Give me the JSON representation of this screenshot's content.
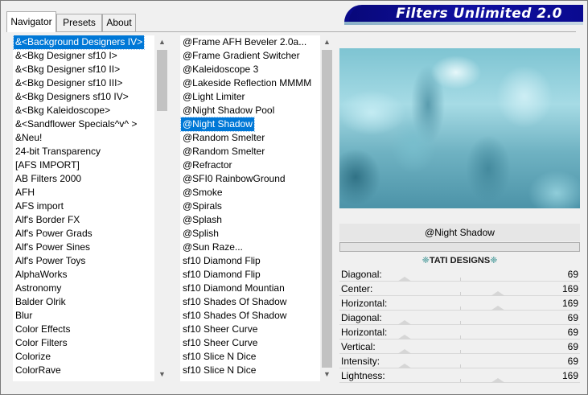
{
  "tabs": [
    {
      "label": "Navigator",
      "active": true
    },
    {
      "label": "Presets",
      "active": false
    },
    {
      "label": "About",
      "active": false
    }
  ],
  "banner": {
    "title": "Filters Unlimited 2.0"
  },
  "categories": {
    "selected_index": 0,
    "items": [
      "&<Background Designers IV>",
      "&<Bkg Designer sf10 I>",
      "&<Bkg Designer sf10 II>",
      "&<Bkg Designer sf10 III>",
      "&<Bkg Designers sf10 IV>",
      "&<Bkg Kaleidoscope>",
      "&<Sandflower Specials^v^ >",
      "&Neu!",
      "24-bit Transparency",
      "[AFS IMPORT]",
      "AB Filters 2000",
      "AFH",
      "AFS import",
      "Alf's Border FX",
      "Alf's Power Grads",
      "Alf's Power Sines",
      "Alf's Power Toys",
      "AlphaWorks",
      "Astronomy",
      "Balder Olrik",
      "Blur",
      "Color Effects",
      "Color Filters",
      "Colorize",
      "ColorRave"
    ]
  },
  "filters": {
    "selected_index": 6,
    "items": [
      "@Frame AFH Beveler 2.0a...",
      "@Frame Gradient Switcher",
      "@Kaleidoscope 3",
      "@Lakeside Reflection MMMM",
      "@Light Limiter",
      "@Night Shadow Pool",
      "@Night Shadow",
      "@Random Smelter",
      "@Random Smelter",
      "@Refractor",
      "@SFI0 RainbowGround",
      "@Smoke",
      "@Spirals",
      "@Splash",
      "@Splish",
      "@Sun Raze...",
      "sf10 Diamond Flip",
      "sf10 Diamond Flip",
      "sf10 Diamond Mountian",
      "sf10 Shades Of Shadow",
      "sf10 Shades Of Shadow",
      "sf10 Sheer Curve",
      "sf10 Sheer Curve",
      "sf10 Slice N Dice",
      "sf10 Slice N Dice"
    ]
  },
  "filter_panel": {
    "name": "@Night Shadow",
    "author": "TATI DESIGNS",
    "author_ornament": "❈",
    "params": [
      {
        "label": "Diagonal:",
        "value": "69",
        "level": 0.27
      },
      {
        "label": "Center:",
        "value": "169",
        "level": 0.66
      },
      {
        "label": "Horizontal:",
        "value": "169",
        "level": 0.66
      },
      {
        "label": "Diagonal:",
        "value": "69",
        "level": 0.27
      },
      {
        "label": "Horizontal:",
        "value": "69",
        "level": 0.27
      },
      {
        "label": "Vertical:",
        "value": "69",
        "level": 0.27
      },
      {
        "label": "Intensity:",
        "value": "69",
        "level": 0.27
      },
      {
        "label": "Lightness:",
        "value": "169",
        "level": 0.66
      }
    ]
  },
  "icons": {
    "scroll_up": "chevron-up-icon",
    "scroll_down": "chevron-down-icon"
  },
  "colors": {
    "selection": "#0078d7",
    "banner": "#0a0a8a"
  }
}
